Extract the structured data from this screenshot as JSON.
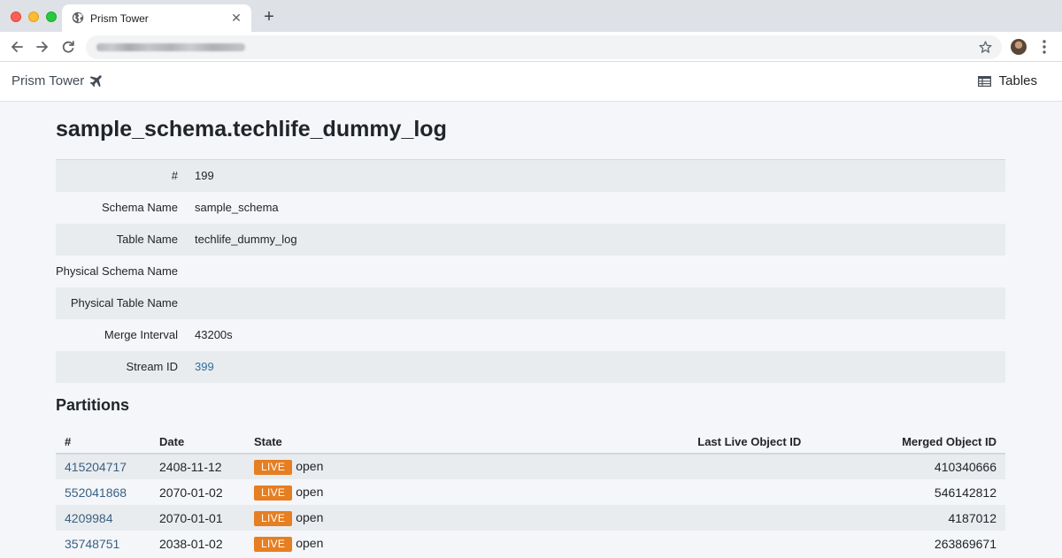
{
  "browser": {
    "tab_title": "Prism Tower",
    "tab_close": "✕",
    "new_tab": "+"
  },
  "navbar": {
    "brand": "Prism Tower",
    "tables_label": "Tables"
  },
  "page": {
    "title": "sample_schema.techlife_dummy_log"
  },
  "details": [
    {
      "label": "#",
      "value": "199"
    },
    {
      "label": "Schema Name",
      "value": "sample_schema"
    },
    {
      "label": "Table Name",
      "value": "techlife_dummy_log"
    },
    {
      "label": "Physical Schema Name",
      "value": ""
    },
    {
      "label": "Physical Table Name",
      "value": ""
    },
    {
      "label": "Merge Interval",
      "value": "43200s"
    },
    {
      "label": "Stream ID",
      "value": "399"
    }
  ],
  "partitions": {
    "title": "Partitions",
    "columns": [
      "#",
      "Date",
      "State",
      "Last Live Object ID",
      "Merged Object ID"
    ],
    "rows": [
      {
        "id": "415204717",
        "date": "2408-11-12",
        "badge": "LIVE",
        "state": "open",
        "last_live": "",
        "merged": "410340666"
      },
      {
        "id": "552041868",
        "date": "2070-01-02",
        "badge": "LIVE",
        "state": "open",
        "last_live": "",
        "merged": "546142812"
      },
      {
        "id": "4209984",
        "date": "2070-01-01",
        "badge": "LIVE",
        "state": "open",
        "last_live": "",
        "merged": "4187012"
      },
      {
        "id": "35748751",
        "date": "2038-01-02",
        "badge": "LIVE",
        "state": "open",
        "last_live": "",
        "merged": "263869671"
      }
    ]
  },
  "colors": {
    "badge_live": "#e67e22",
    "link": "#2f6f9f"
  },
  "icons": {
    "brand": "airplane-icon",
    "tables": "table-icon"
  }
}
